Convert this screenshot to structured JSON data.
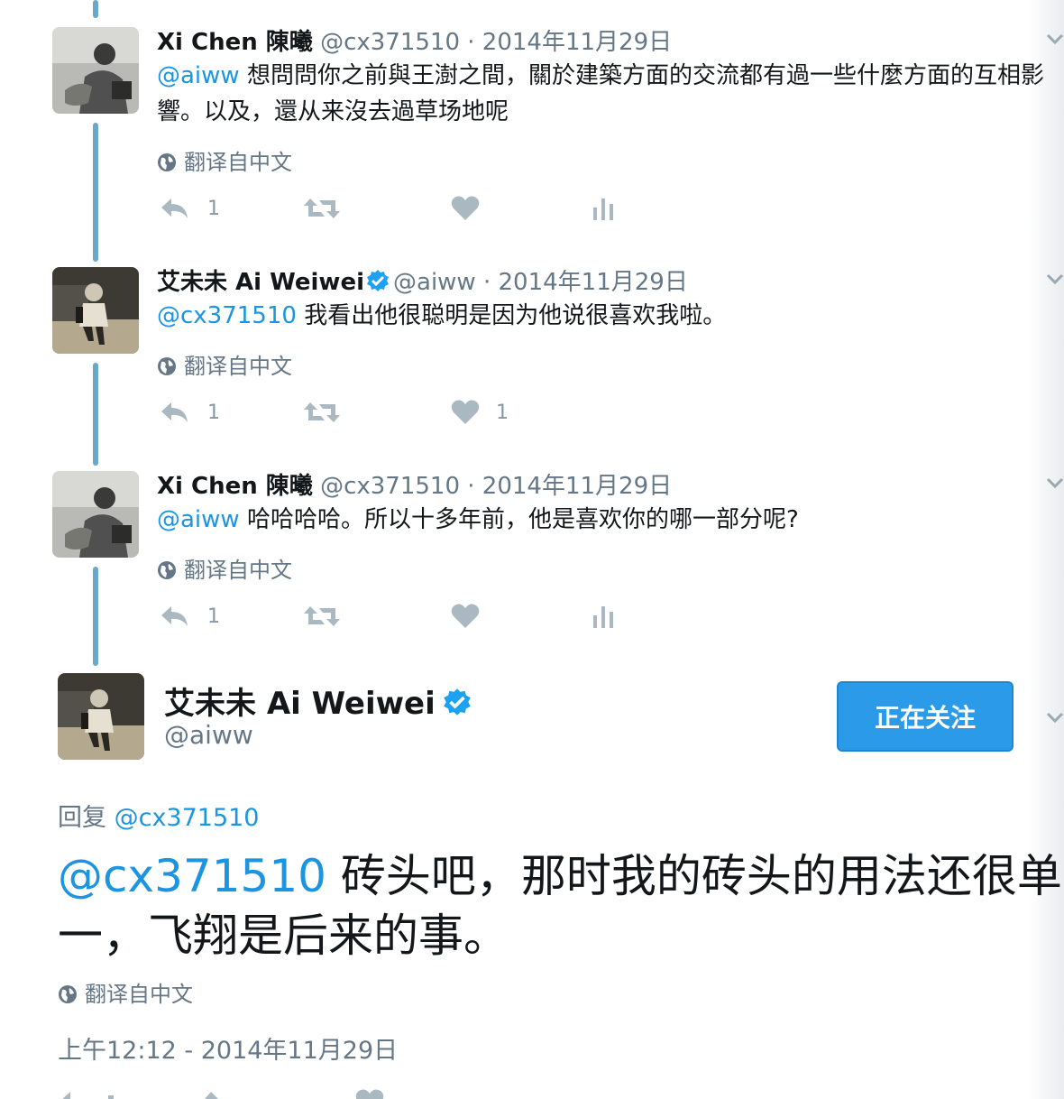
{
  "thread": [
    {
      "name": "Xi Chen 陳曦",
      "handle": "@cx371510",
      "separator": "·",
      "date": "2014年11月29日",
      "mention": "@aiww",
      "text": " 想問問你之前與王澍之間，關於建築方面的交流都有過一些什麼方面的互相影響。以及，還从来沒去過草场地呢",
      "translate": "翻译自中文",
      "reply_count": "1",
      "like_count": ""
    },
    {
      "name": "艾未未 Ai Weiwei",
      "handle": "@aiww",
      "separator": "·",
      "date": "2014年11月29日",
      "mention": "@cx371510",
      "text": " 我看出他很聪明是因为他说很喜欢我啦。",
      "translate": "翻译自中文",
      "reply_count": "1",
      "like_count": "1"
    },
    {
      "name": "Xi Chen 陳曦",
      "handle": "@cx371510",
      "separator": "·",
      "date": "2014年11月29日",
      "mention": "@aiww",
      "text": " 哈哈哈哈。所以十多年前，他是喜欢你的哪一部分呢?",
      "translate": "翻译自中文",
      "reply_count": "1",
      "like_count": ""
    }
  ],
  "main_tweet": {
    "name": "艾未未 Ai Weiwei",
    "handle": "@aiww",
    "follow_label": "正在关注",
    "reply_prefix": "回复",
    "reply_to": "@cx371510",
    "mention": "@cx371510",
    "text": " 砖头吧，那时我的砖头的用法还很单一，飞翔是后来的事。",
    "translate": "翻译自中文",
    "timestamp": "上午12:12 - 2014年11月29日"
  },
  "colors": {
    "link": "#1b95e0",
    "thread_line": "#6aa8c9",
    "muted": "#657786",
    "follow_button": "#2b9ae8"
  },
  "icons": [
    "globe-icon",
    "reply-icon",
    "retweet-icon",
    "heart-icon",
    "analytics-icon",
    "chevron-down-icon",
    "verified-icon"
  ]
}
